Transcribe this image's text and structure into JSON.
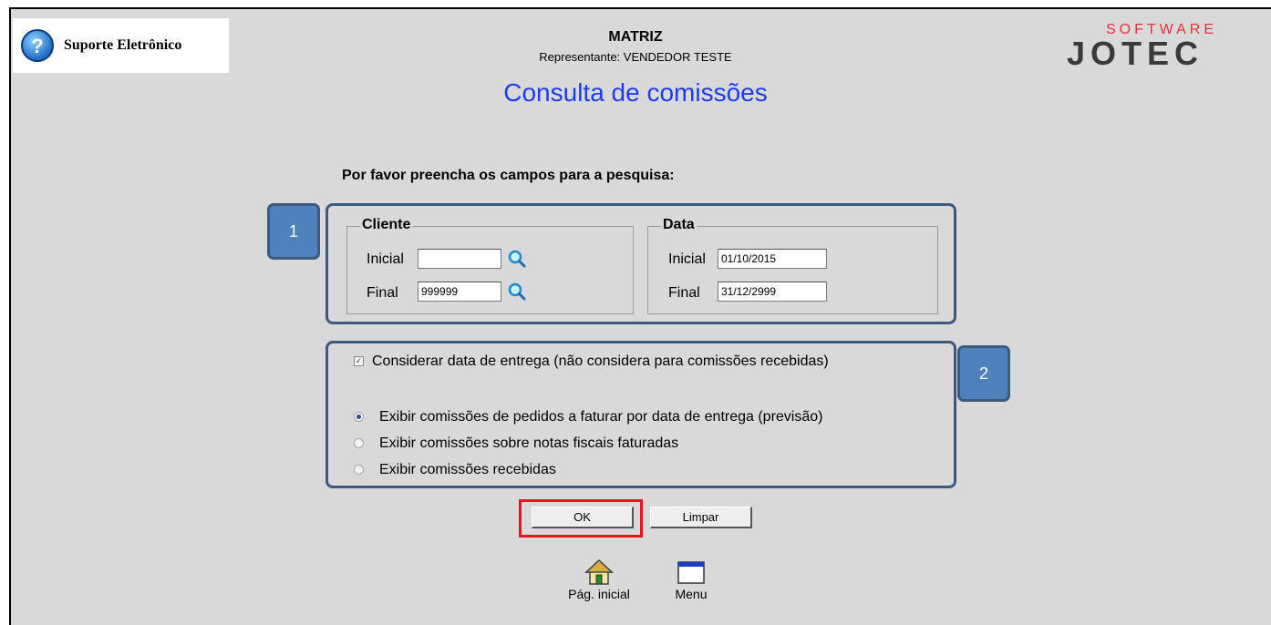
{
  "header": {
    "support_label": "Suporte Eletrônico",
    "company": "MATRIZ",
    "representative": "Representante: VENDEDOR TESTE",
    "page_title": "Consulta de comissões",
    "logo_top": "SOFTWARE",
    "logo_bottom": "JOTEC"
  },
  "form": {
    "prompt": "Por favor preencha os campos para a pesquisa:",
    "cliente": {
      "legend": "Cliente",
      "inicial_label": "Inicial",
      "inicial_value": "",
      "final_label": "Final",
      "final_value": "999999"
    },
    "data": {
      "legend": "Data",
      "inicial_label": "Inicial",
      "inicial_value": "01/10/2015",
      "final_label": "Final",
      "final_value": "31/12/2999"
    },
    "consider_delivery": {
      "label": "Considerar data de entrega (não considera para comissões recebidas)",
      "checked": true
    },
    "options": [
      {
        "label": "Exibir comissões de pedidos a faturar por data de entrega (previsão)",
        "selected": true
      },
      {
        "label": "Exibir comissões sobre notas fiscais faturadas",
        "selected": false
      },
      {
        "label": "Exibir comissões recebidas",
        "selected": false
      }
    ],
    "ok_label": "OK",
    "clear_label": "Limpar"
  },
  "badges": {
    "one": "1",
    "two": "2"
  },
  "nav": {
    "home_label": "Pág. inicial",
    "menu_label": "Menu"
  },
  "colors": {
    "title_blue": "#1d3cf0",
    "badge_blue": "#4f81bd",
    "highlight_red": "#e8141b",
    "logo_red": "#e8303c"
  }
}
